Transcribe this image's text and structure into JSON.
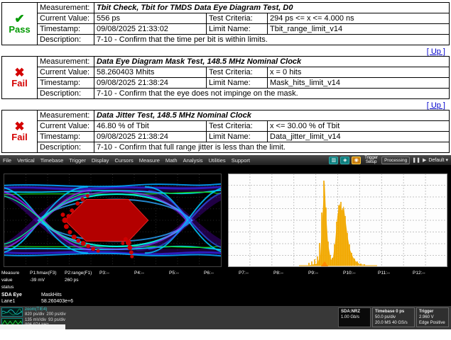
{
  "report": {
    "up_label": "[ Up ]",
    "icons": {
      "pass": "✔",
      "fail": "✖"
    },
    "labels": {
      "measurement": "Measurement:",
      "current_value": "Current Value:",
      "test_criteria": "Test Criteria:",
      "timestamp": "Timestamp:",
      "limit_name": "Limit Name:",
      "description": "Description:"
    },
    "tests": [
      {
        "status": "Pass",
        "measurement": "Tbit Check, Tbit for TMDS Data Eye Diagram Test, D0",
        "current_value": "556 ps",
        "test_criteria": "294 ps <= x <= 4.000 ns",
        "timestamp": "09/08/2025 21:33:02",
        "limit_name": "Tbit_range_limit_v14",
        "description": "7-10 - Confirm that the time per bit is within limits."
      },
      {
        "status": "Fail",
        "measurement": "Data Eye Diagram Mask Test, 148.5 MHz Nominal Clock",
        "current_value": "58.260403 Mhits",
        "test_criteria": "x = 0 hits",
        "timestamp": "09/08/2025 21:38:24",
        "limit_name": "Mask_hits_limit_v14",
        "description": "7-10 - Confirm that the eye does not impinge on the mask."
      },
      {
        "status": "Fail",
        "measurement": "Data Jitter Test, 148.5 MHz Nominal Clock",
        "current_value": "46.80 % of Tbit",
        "test_criteria": "x <= 30.00 % of Tbit",
        "timestamp": "09/08/2025 21:38:24",
        "limit_name": "Data_jitter_limit_v14",
        "description": "7-10 - Confirm that full range jitter is less than the limit."
      }
    ]
  },
  "scope": {
    "menu": [
      "File",
      "Vertical",
      "Timebase",
      "Trigger",
      "Display",
      "Cursors",
      "Measure",
      "Math",
      "Analysis",
      "Utilities",
      "Support"
    ],
    "toolbar": {
      "trigger_setup": {
        "l1": "Trigger",
        "l2": "Setup"
      },
      "processing": "Processing",
      "default_label": "Default"
    },
    "measure": {
      "row_labels": [
        "Measure",
        "value",
        "status"
      ],
      "headers": [
        "P1:hmax(F3)",
        "P2:range(F1)",
        "P3:--",
        "P4:--",
        "P5:--",
        "P6:--",
        "P7:--",
        "P8:--",
        "P9:--",
        "P10:--",
        "P11:--",
        "P12:--"
      ],
      "values": [
        "-39 mV",
        "260 ps",
        "",
        "",
        "",
        "",
        "",
        "",
        "",
        "",
        "",
        ""
      ]
    },
    "sda": {
      "title": "SDA Eye",
      "column": "MaskHits",
      "lane": "Lane1",
      "value": "58.260403e+6"
    },
    "zoom1": {
      "title": "zoom(TIE4)",
      "l1": "820 ps/div",
      "l2": "200 ps/div"
    },
    "zoom2": {
      "l1": "135 mV/div",
      "l2": "93 ps/div",
      "l3": "996.974 kHz"
    },
    "info_boxes": {
      "sda_nrz": {
        "l1": "SDA:NRZ",
        "l2": "1.00 Gb/s"
      },
      "timebase": {
        "l1": "Timebase  0 ps",
        "l2": "50.0 ps/div",
        "l3": "20.0 MS  40 GS/s"
      },
      "trigger": {
        "l1": "Trigger",
        "l2": "2.960 V",
        "l3": "Edge  Positive"
      }
    },
    "colors": {
      "pass_green": "#009900",
      "fail_red": "#d40000",
      "accent_teal": "#0e7f7f",
      "histogram_gold": "#f2a800",
      "mask_red": "#b30000"
    }
  }
}
